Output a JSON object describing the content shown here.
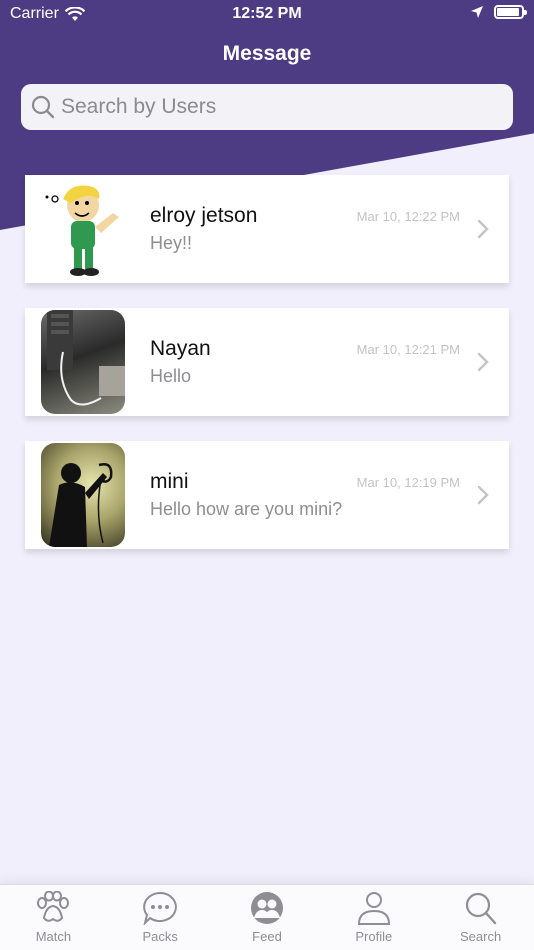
{
  "status_bar": {
    "carrier": "Carrier",
    "time": "12:52 PM"
  },
  "header": {
    "title": "Message"
  },
  "search": {
    "placeholder": "Search by Users",
    "value": ""
  },
  "conversations": [
    {
      "name": "elroy jetson",
      "preview": "Hey!!",
      "time": "Mar 10, 12:22 PM",
      "avatar_icon": "cartoon-boy-avatar"
    },
    {
      "name": "Nayan",
      "preview": "Hello",
      "time": "Mar 10, 12:21 PM",
      "avatar_icon": "photo-avatar"
    },
    {
      "name": "mini",
      "preview": "Hello how are you mini?",
      "time": "Mar 10, 12:19 PM",
      "avatar_icon": "silhouette-avatar"
    }
  ],
  "tabs": [
    {
      "label": "Match",
      "icon": "paw-icon"
    },
    {
      "label": "Packs",
      "icon": "chat-bubble-icon"
    },
    {
      "label": "Feed",
      "icon": "people-icon"
    },
    {
      "label": "Profile",
      "icon": "person-icon"
    },
    {
      "label": "Search",
      "icon": "search-icon"
    }
  ],
  "colors": {
    "header": "#4d3b83",
    "background": "#f1effb",
    "tab_inactive": "#8e8e93"
  }
}
